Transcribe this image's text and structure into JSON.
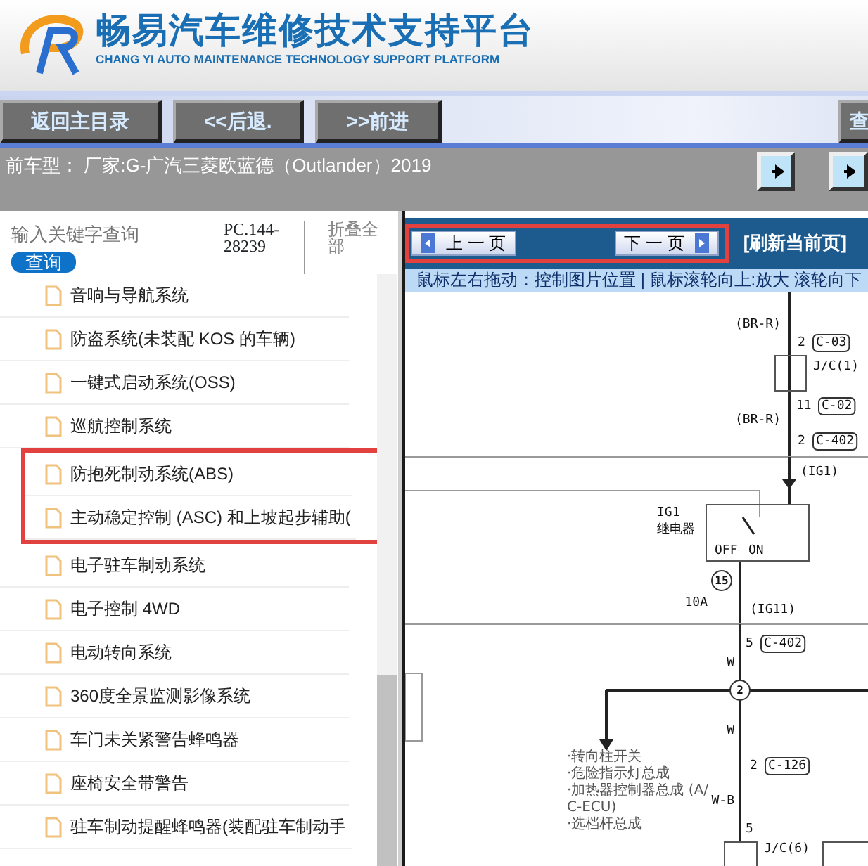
{
  "header": {
    "title": "畅易汽车维修技术支持平台",
    "subtitle": "CHANG YI AUTO MAINTENANCE TECHNOLOGY SUPPORT PLATFORM"
  },
  "toolbar": {
    "buttons": [
      "返回主目录",
      "<<后退.",
      ">>前进"
    ],
    "right_button": "查"
  },
  "vehicle_bar": {
    "text": "前车型： 厂家:G-广汽三菱欧蓝德（Outlander）2019"
  },
  "sidebar": {
    "search": {
      "placeholder": "输入关键字查询",
      "button": "查询"
    },
    "code": "PC.144-28239",
    "collapse": "折叠全部",
    "items": [
      {
        "label": "音响与导航系统",
        "highlighted": false
      },
      {
        "label": "防盗系统(未装配 KOS 的车辆)",
        "highlighted": false
      },
      {
        "label": "一键式启动系统(OSS)",
        "highlighted": false
      },
      {
        "label": "巡航控制系统",
        "highlighted": false
      },
      {
        "label": "防抱死制动系统(ABS)",
        "highlighted": true
      },
      {
        "label": "主动稳定控制 (ASC) 和上坡起步辅助(",
        "highlighted": true
      },
      {
        "label": "电子驻车制动系统",
        "highlighted": false
      },
      {
        "label": "电子控制 4WD",
        "highlighted": false
      },
      {
        "label": "电动转向系统",
        "highlighted": false
      },
      {
        "label": "360度全景监测影像系统",
        "highlighted": false
      },
      {
        "label": "车门未关紧警告蜂鸣器",
        "highlighted": false
      },
      {
        "label": "座椅安全带警告",
        "highlighted": false
      },
      {
        "label": "驻车制动提醒蜂鸣器(装配驻车制动手",
        "highlighted": false
      }
    ]
  },
  "viewer": {
    "prev": "上 一 页",
    "next": "下 一 页",
    "nav_highlighted": true,
    "refresh": "[刷新当前页]",
    "hint": "鼠标左右拖动：控制图片位置 | 鼠标滚轮向上:放大  滚轮向下",
    "diagram": {
      "labels": [
        "(BR-R)",
        "2",
        "C-03",
        "J/C(1)",
        "11",
        "C-02",
        "(BR-R)",
        "2",
        "C-402",
        "(IG1)",
        "IG1",
        "继电器",
        "OFF",
        "ON",
        "15",
        "10A",
        "(IG11)",
        "5",
        "C-402",
        "W",
        "2",
        "W",
        "2",
        "C-126",
        "W-B",
        "5",
        "J/C(6)"
      ],
      "notes": [
        "·转向柱开关",
        "·危险指示灯总成",
        "·加热器控制器总成 (A/",
        "C-ECU)",
        "·选档杆总成"
      ]
    }
  }
}
